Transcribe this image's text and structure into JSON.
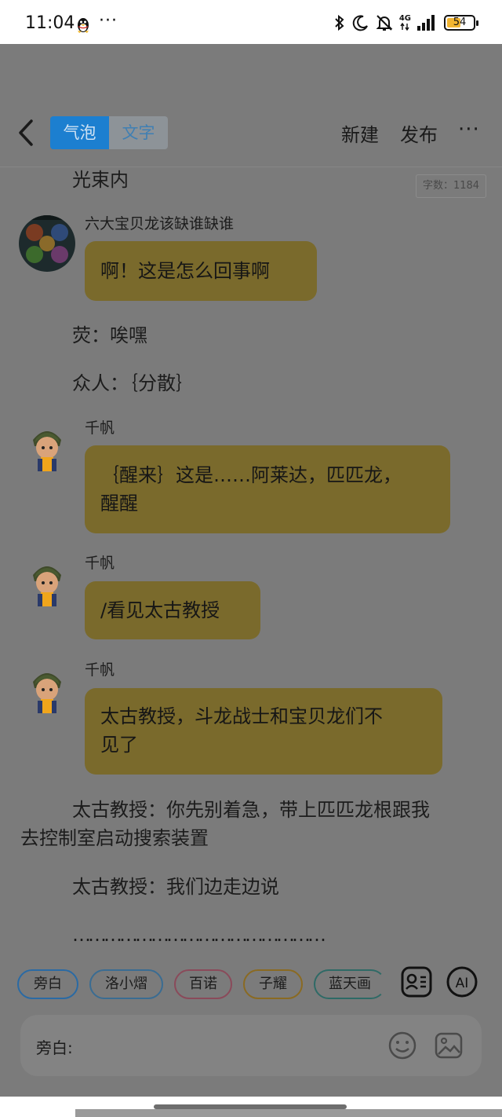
{
  "status_bar": {
    "time": "11:04",
    "dots": "···",
    "network": "4G",
    "battery": "54"
  },
  "header": {
    "tabs": [
      {
        "label": "气泡",
        "active": true
      },
      {
        "label": "文字",
        "active": false
      }
    ],
    "new_label": "新建",
    "publish_label": "发布",
    "more_label": "···"
  },
  "word_count": "字数：1184",
  "messages": {
    "top_text": "光束内",
    "m1": {
      "name": "六大宝贝龙该缺谁缺谁",
      "text": "啊！这是怎么回事啊"
    },
    "n1": "荧：唉嘿",
    "n2": "众人：｛分散｝",
    "m2": {
      "name": "千帆",
      "line1": "｛醒来｝这是……阿莱达，匹匹龙，",
      "line2": "醒醒"
    },
    "m3": {
      "name": "千帆",
      "text": "/看见太古教授"
    },
    "m4": {
      "name": "千帆",
      "line1": "太古教授，斗龙战士和宝贝龙们不",
      "line2": "见了"
    },
    "n3_line1": "太古教授：你先别着急，带上匹匹龙根跟我",
    "n3_line2": "去控制室启动搜索装置",
    "n4": "太古教授：我们边走边说",
    "n5": "…………………………………………"
  },
  "roles": [
    "旁白",
    "洛小熠",
    "百诺",
    "子耀",
    "蓝天画"
  ],
  "input": {
    "label": "旁白:"
  },
  "colors": {
    "bubble": "#7a6a2c",
    "accent": "#1c7fd0",
    "background": "#7b7b7b"
  }
}
